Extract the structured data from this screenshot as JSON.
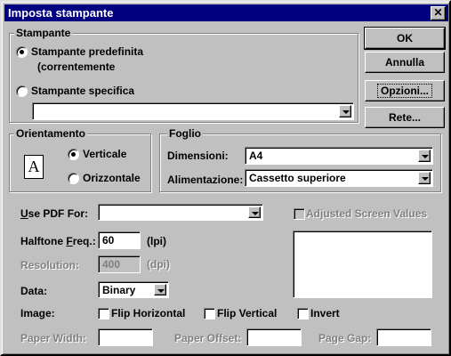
{
  "window": {
    "title": "Imposta stampante",
    "close": "✕"
  },
  "printer_group": {
    "label": "Stampante",
    "default_option": "Stampante predefinita",
    "default_sub": "(correntemente",
    "specific_option": "Stampante specifica",
    "specific_value": ""
  },
  "buttons": {
    "ok": "OK",
    "cancel": "Annulla",
    "options": "Opzioni...",
    "network": "Rete..."
  },
  "orientation_group": {
    "label": "Orientamento",
    "portrait": "Verticale",
    "landscape": "Orizzontale",
    "icon_letter": "A"
  },
  "paper_group": {
    "label": "Foglio",
    "size_label": "Dimensioni:",
    "size_value": "A4",
    "source_label": "Alimentazione:",
    "source_value": "Cassetto superiore"
  },
  "pdf": {
    "label_pre": "",
    "label_u": "U",
    "label_post": "se PDF For:",
    "value": "",
    "adjusted": "Adjusted Screen Values"
  },
  "halftone": {
    "label_pre": "Halftone ",
    "label_u": "F",
    "label_post": "req.:",
    "value": "60",
    "unit": "(lpi)"
  },
  "resolution": {
    "label": "Resolution:",
    "value": "400",
    "unit": "(dpi)"
  },
  "data_row": {
    "label": "Data:",
    "value": "Binary"
  },
  "image_row": {
    "label": "Image:",
    "flip_h": "Flip Horizontal",
    "flip_v": "Flip Vertical",
    "invert": "Invert"
  },
  "paper_row": {
    "width_label": "Paper Width:",
    "offset_label": "Paper Offset:",
    "gap_label": "Page Gap:"
  }
}
